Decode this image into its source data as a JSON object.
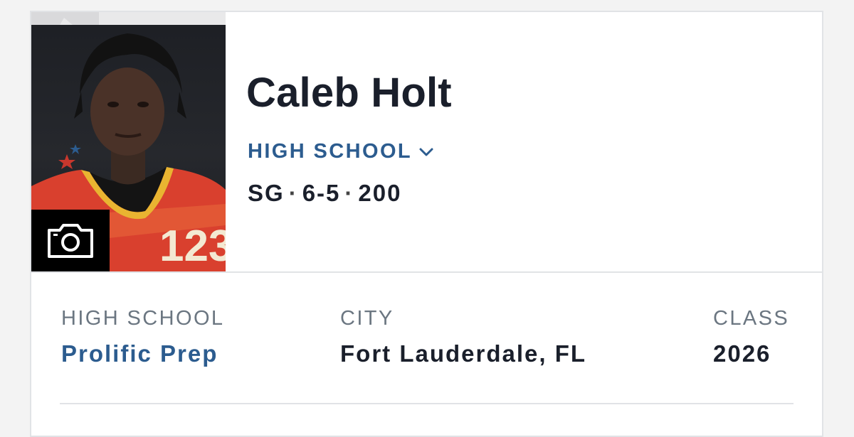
{
  "player": {
    "name": "Caleb Holt",
    "level_label": "HIGH SCHOOL",
    "position": "SG",
    "height": "6-5",
    "weight": "200",
    "separator": "·"
  },
  "details": {
    "high_school_label": "HIGH SCHOOL",
    "high_school_value": "Prolific Prep",
    "city_label": "CITY",
    "city_value": "Fort Lauderdale, FL",
    "class_label": "CLASS",
    "class_value": "2026"
  },
  "photo": {
    "jersey_number": "123"
  },
  "icons": {
    "camera": "camera-icon",
    "chevron": "chevron-down-icon"
  },
  "colors": {
    "link_blue": "#2c5c8f",
    "text_dark": "#1a1f2b",
    "label_gray": "#6b7681"
  }
}
